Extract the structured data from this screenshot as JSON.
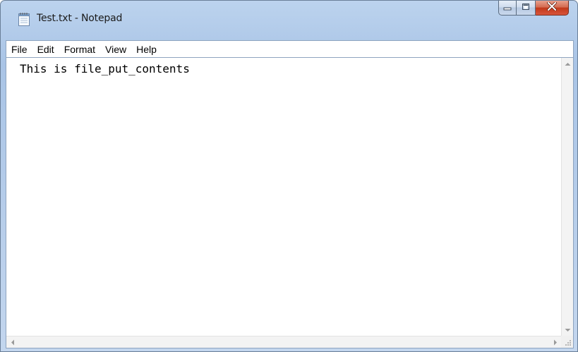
{
  "window": {
    "title": "Test.txt - Notepad"
  },
  "menu": {
    "items": [
      "File",
      "Edit",
      "Format",
      "View",
      "Help"
    ]
  },
  "editor": {
    "content": "This is file_put_contents"
  },
  "icons": {
    "app": "notepad-icon",
    "minimize": "minimize-icon",
    "maximize": "maximize-icon",
    "close": "close-icon"
  },
  "colors": {
    "titlebar": "#b6cdea",
    "close_button": "#c2391a",
    "editor_background": "#ffffff"
  }
}
